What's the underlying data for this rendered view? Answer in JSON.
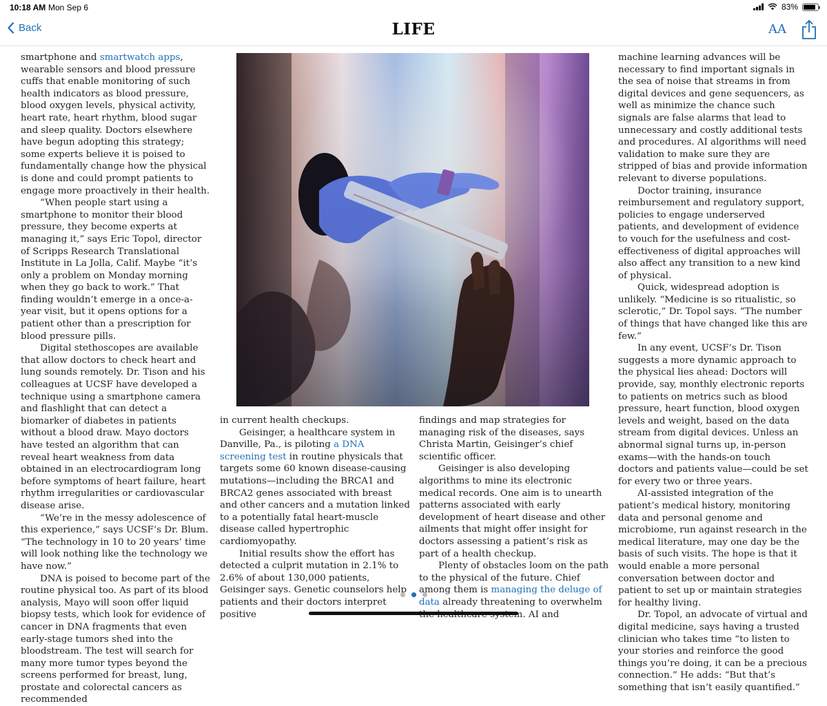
{
  "status": {
    "time": "10:18 AM",
    "date": "Mon Sep 6",
    "battery": "83%",
    "battery_level": 0.83,
    "icons": [
      "signal-icon",
      "wifi-icon",
      "battery-icon"
    ]
  },
  "nav": {
    "back_label": "Back",
    "back_icon": "chevron-left-icon",
    "logo": "LIFE",
    "text_size_label": "AA",
    "share_icon": "share-icon",
    "accent_color": "#1f6fb6"
  },
  "article": {
    "col1": {
      "p1_pre": "smartphone and ",
      "p1_link": "smartwatch apps",
      "p1_post": ", wearable sensors and blood pressure cuffs that enable monitoring of such health indicators as blood pressure, blood oxygen levels, physical activity, heart rate, heart rhythm, blood sugar and sleep quality. Doctors elsewhere have begun adopting this strategy; some experts believe it is poised to fundamentally change how the physical is done and could prompt patients to engage more proactively in their health.",
      "p2": "“When people start using a smartphone to monitor their blood pressure, they become experts at managing it,” says Eric Topol, director of Scripps Research Translational Institute in La Jolla, Calif. Maybe “it’s only a problem on Monday morning when they go back to work.” That finding wouldn’t emerge in a once-a-year visit, but it opens options for a patient other than a prescription for blood pressure pills.",
      "p3": "Digital stethoscopes are available that allow doctors to check heart and lung sounds remotely. Dr. Tison and his colleagues at UCSF have developed a technique using a smartphone camera and flashlight that can detect a biomarker of diabetes in patients without a blood draw. Mayo doctors have tested an algorithm that can reveal heart weakness from data obtained in an electrocardiogram long before symptoms of heart failure, heart rhythm irregularities or cardiovascular disease arise.",
      "p4": "“We’re in the messy adolescence of this experience,” says UCSF’s Dr. Blum. “The technology in 10 to 20 years’ time will look nothing like the technology we have now.”",
      "p5": "DNA is poised to become part of the routine physical too. As part of its blood analysis, Mayo will soon offer liquid biopsy tests, which look for evidence of cancer in DNA fragments that even early-stage tumors shed into the bloodstream. The test will search for many more tumor types beyond the screens performed for breast, lung, prostate and colorectal cancers as recommended"
    },
    "col2": {
      "p1": "in current health checkups.",
      "p2_pre": "Geisinger, a healthcare system in Danville, Pa., is piloting ",
      "p2_link": "a DNA screening test",
      "p2_post": " in routine physicals that targets some 60 known disease-causing mutations—including the BRCA1 and BRCA2 genes associated with breast and other cancers and a mutation linked to a potentially fatal heart-muscle disease called hypertrophic cardiomyopathy.",
      "p3": "Initial results show the effort has detected a culprit mutation in 2.1% to 2.6% of about 130,000 patients, Geisinger says. Genetic counselors help patients and their doctors interpret positive"
    },
    "col3": {
      "p1": "findings and map strategies for managing risk of the diseases, says Christa Martin, Geisinger’s chief scientific officer.",
      "p2": "Geisinger is also developing algorithms to mine its electronic medical records. One aim is to unearth patterns associated with early development of heart disease and other ailments that might offer insight for doctors assessing a patient’s risk as part of a health checkup.",
      "p3_pre": "Plenty of obstacles loom on the path to the physical of the future. Chief among them is ",
      "p3_link": "managing the deluge of data",
      "p3_post": " already threatening to overwhelm the healthcare system. AI and"
    },
    "col4": {
      "p1": "machine learning advances will be necessary to find important signals in the sea of noise that streams in from digital devices and gene sequencers, as well as minimize the chance such signals are false alarms that lead to unnecessary and costly additional tests and procedures. AI algorithms will need validation to make sure they are stripped of bias and provide information relevant to diverse populations.",
      "p2": "Doctor training, insurance reimbursement and regulatory support, policies to engage underserved patients, and development of evidence to vouch for the usefulness and cost-effectiveness of digital approaches will also affect any transition to a new kind of physical.",
      "p3": "Quick, widespread adoption is unlikely. “Medicine is so ritualistic, so sclerotic,” Dr. Topol says. “The number of things that have changed like this are few.”",
      "p4": "In any event, UCSF’s Dr. Tison suggests a more dynamic approach to the physical lies ahead: Doctors will provide, say, monthly electronic reports to patients on metrics such as blood pressure, heart function, blood oxygen levels and weight, based on the data stream from digital devices. Unless an abnormal signal turns up, in-person exams—with the hands-on touch doctors and patients value—could be set for every two or three years.",
      "p5": "AI-assisted integration of the patient’s medical history, monitoring data and personal genome and microbiome, run against research in the medical literature, may one day be the basis of such visits. The hope is that it would enable a more personal conversation between doctor and patient to set up or maintain strategies for healthy living.",
      "p6": "Dr. Topol, an advocate of virtual and digital medicine, says having a trusted clinician who takes time “to listen to your stories and reinforce the good things you’re doing, it can be a precious connection.” He adds: “But that’s something that isn’t easily quantified.”"
    }
  },
  "pager": {
    "count": 3,
    "active": 2
  }
}
